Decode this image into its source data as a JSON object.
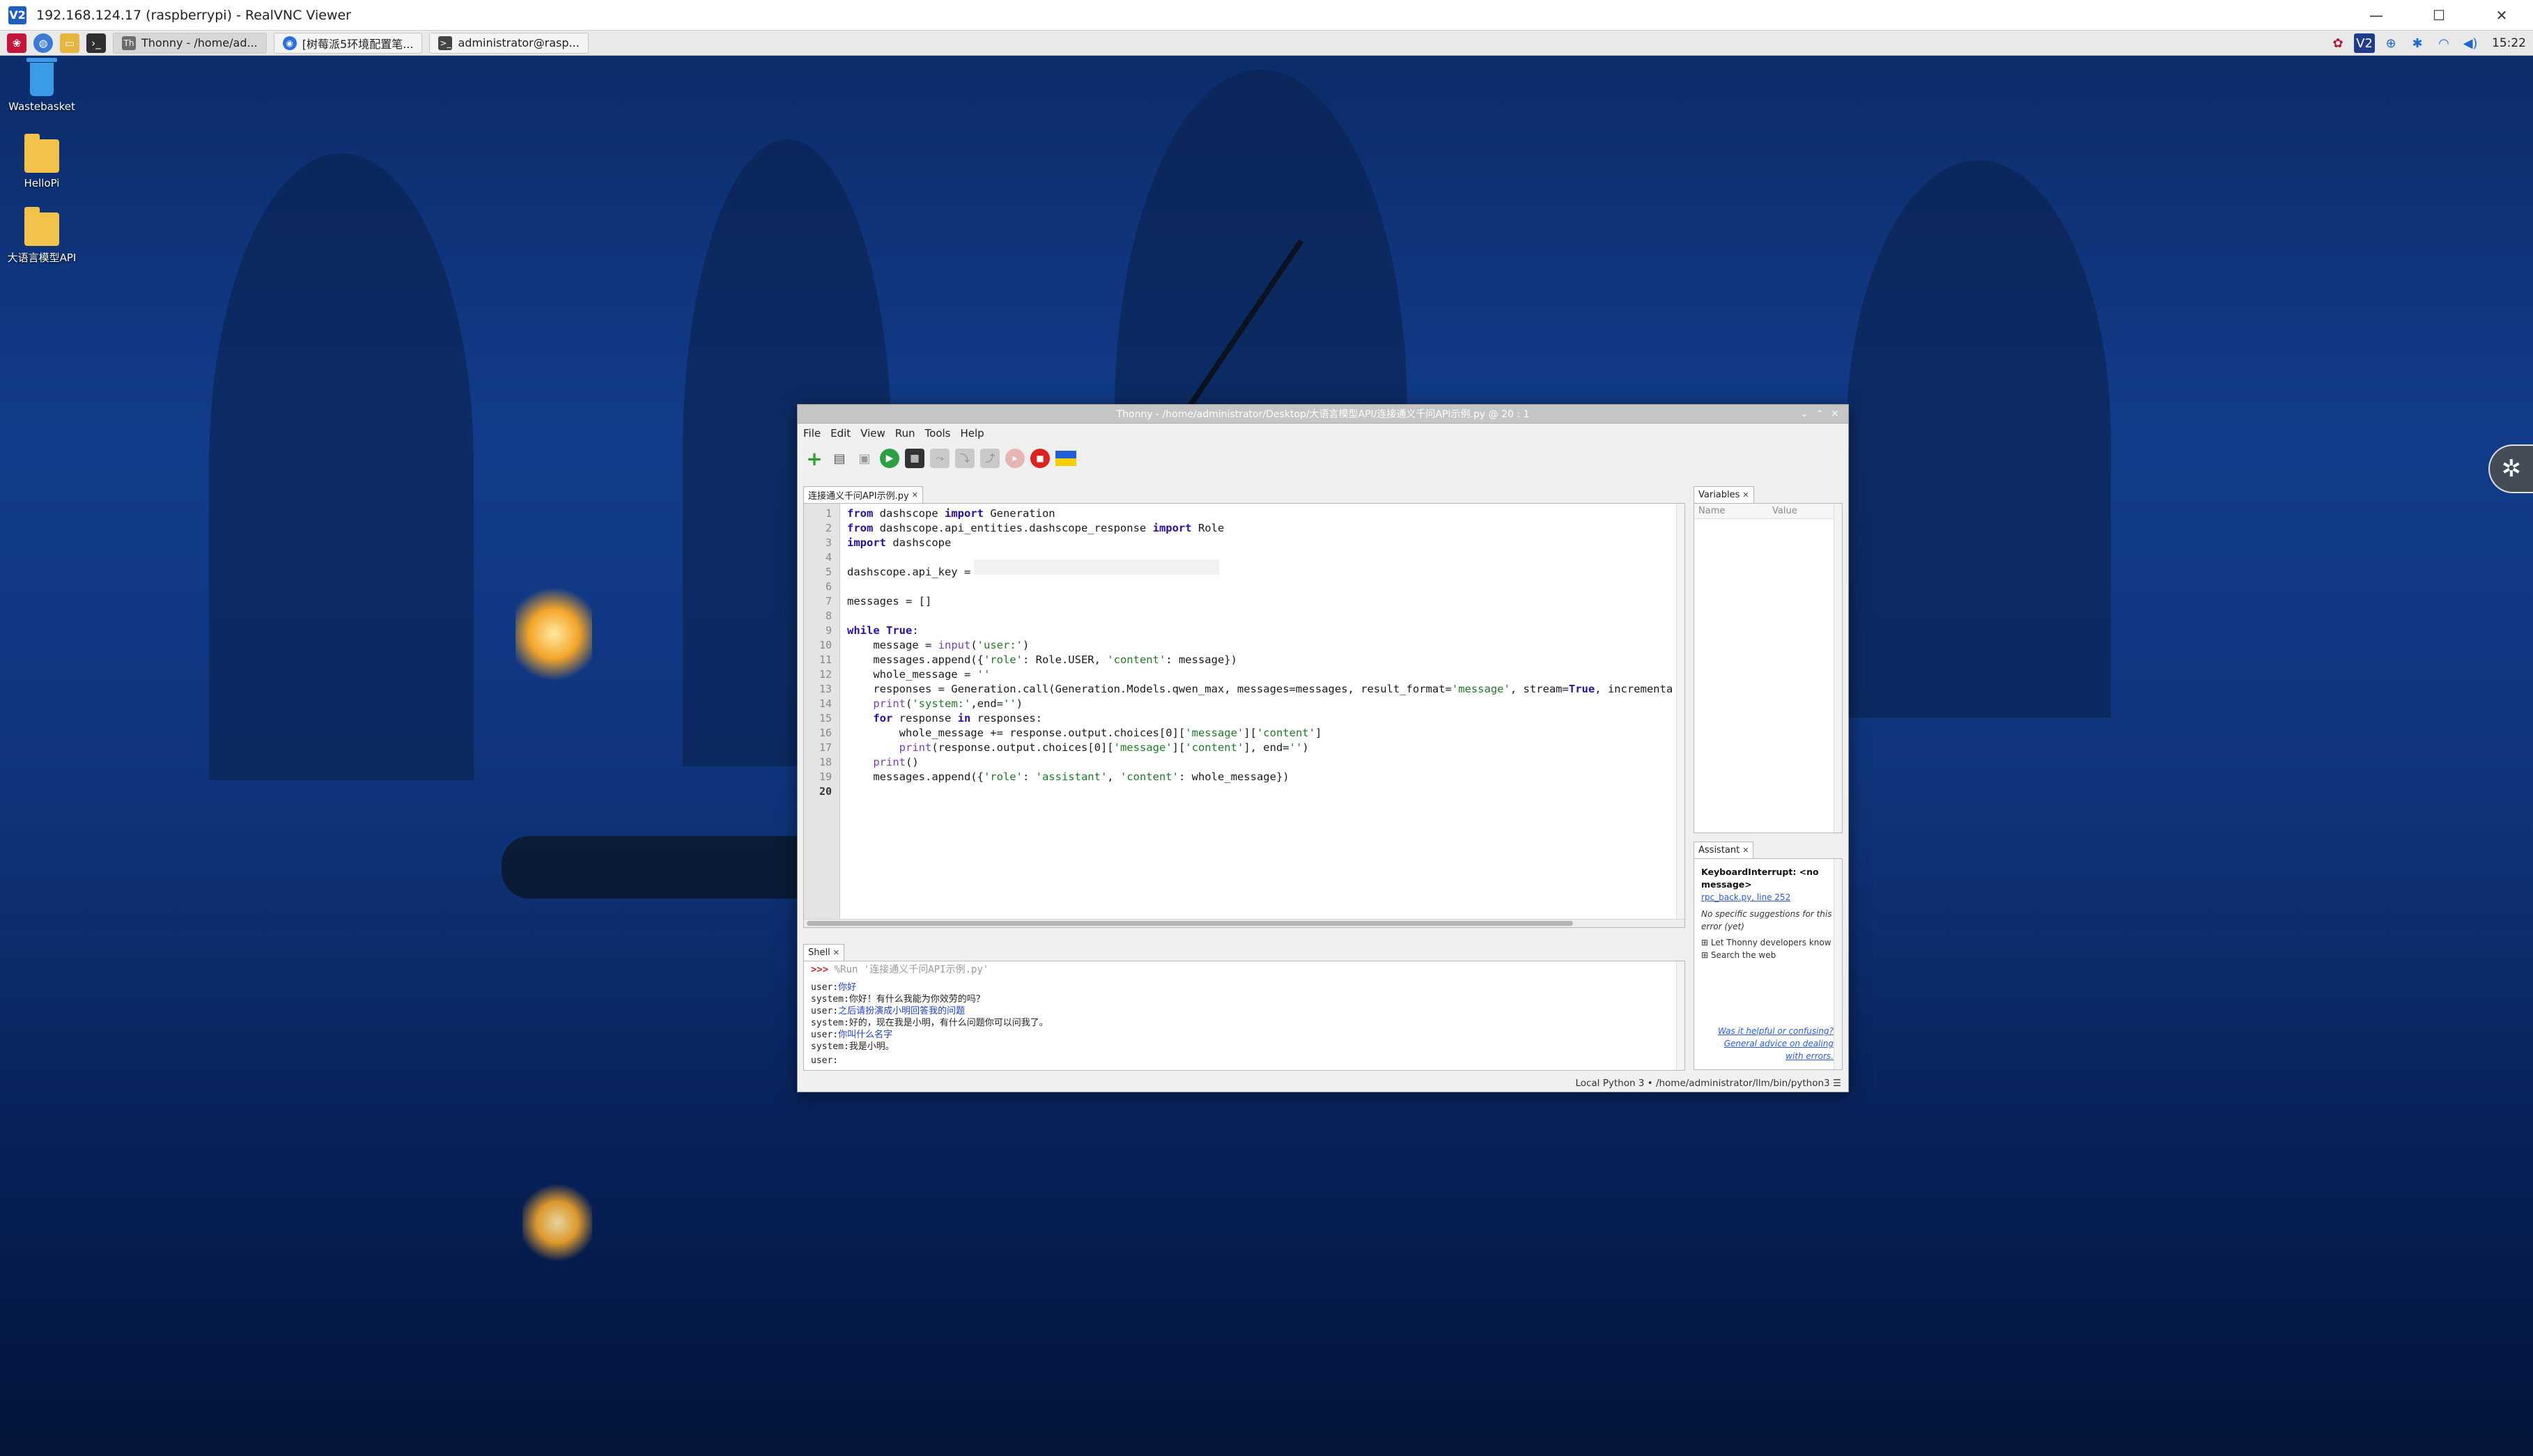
{
  "vnc": {
    "title": "192.168.124.17 (raspberrypi) - RealVNC Viewer",
    "icon": "V2",
    "controls": {
      "minimize": "—",
      "maximize": "☐",
      "close": "✕"
    }
  },
  "taskbar": {
    "tasks": [
      {
        "label": "Thonny - /home/ad...",
        "icon": "Th",
        "icon_color": "#6b6b6b"
      },
      {
        "label": "[树莓派5环境配置笔...",
        "icon": "◉",
        "icon_color": "#2a6fdb"
      },
      {
        "label": "administrator@rasp...",
        "icon": ">_",
        "icon_color": "#444444"
      }
    ],
    "clock": "15:22"
  },
  "desktop": {
    "icons": [
      {
        "label": "Wastebasket",
        "type": "trash"
      },
      {
        "label": "HelloPi",
        "type": "folder"
      },
      {
        "label": "大语言模型API",
        "type": "folder"
      }
    ]
  },
  "thonny": {
    "title": "Thonny  -  /home/administrator/Desktop/大语言模型API/连接通义千问API示例.py  @  20 : 1",
    "menu": [
      "File",
      "Edit",
      "View",
      "Run",
      "Tools",
      "Help"
    ],
    "editor_tab": "连接通义千问API示例.py",
    "code_lines": [
      "1",
      "2",
      "3",
      "4",
      "5",
      "6",
      "7",
      "8",
      "9",
      "10",
      "11",
      "12",
      "13",
      "14",
      "15",
      "16",
      "17",
      "18",
      "19",
      "20"
    ],
    "code": {
      "l1a": "from",
      "l1b": " dashscope ",
      "l1c": "import",
      "l1d": " Generation",
      "l2a": "from",
      "l2b": " dashscope.api_entities.dashscope_response ",
      "l2c": "import",
      "l2d": " Role",
      "l3a": "import",
      "l3b": " dashscope",
      "l5": "dashscope.api_key = ",
      "l7": "messages = []",
      "l9a": "while",
      "l9b": " ",
      "l9c": "True",
      "l9d": ":",
      "l10a": "    message = ",
      "l10b": "input",
      "l10c": "(",
      "l10d": "'user:'",
      "l10e": ")",
      "l11a": "    messages.append({",
      "l11b": "'role'",
      "l11c": ": Role.USER, ",
      "l11d": "'content'",
      "l11e": ": message})",
      "l12a": "    whole_message = ",
      "l12b": "''",
      "l13a": "    responses = Generation.call(Generation.Models.qwen_max, messages=messages, result_format=",
      "l13b": "'message'",
      "l13c": ", stream=",
      "l13d": "True",
      "l13e": ", incrementa",
      "l14a": "    ",
      "l14b": "print",
      "l14c": "(",
      "l14d": "'system:'",
      "l14e": ",end=",
      "l14f": "''",
      "l14g": ")",
      "l15a": "    ",
      "l15b": "for",
      "l15c": " response ",
      "l15d": "in",
      "l15e": " responses:",
      "l16a": "        whole_message += response.output.choices[",
      "l16b": "0",
      "l16c": "][",
      "l16d": "'message'",
      "l16e": "][",
      "l16f": "'content'",
      "l16g": "]",
      "l17a": "        ",
      "l17b": "print",
      "l17c": "(response.output.choices[",
      "l17d": "0",
      "l17e": "][",
      "l17f": "'message'",
      "l17g": "][",
      "l17h": "'content'",
      "l17i": "], end=",
      "l17j": "''",
      "l17k": ")",
      "l18a": "    ",
      "l18b": "print",
      "l18c": "()",
      "l19a": "    messages.append({",
      "l19b": "'role'",
      "l19c": ": ",
      "l19d": "'assistant'",
      "l19e": ", ",
      "l19f": "'content'",
      "l19g": ": whole_message})"
    },
    "shell_tab": "Shell",
    "shell": {
      "prompt": ">>>",
      "run_cmd": " %Run '连接通义千问API示例.py'",
      "lines": [
        {
          "pre": "user:",
          "in": "你好"
        },
        {
          "pre": "system:你好！有什么我能为你效劳的吗？",
          "in": ""
        },
        {
          "pre": "user:",
          "in": "之后请扮演成小明回答我的问题"
        },
        {
          "pre": "system:好的，现在我是小明，有什么问题你可以问我了。",
          "in": ""
        },
        {
          "pre": "user:",
          "in": "你叫什么名字"
        },
        {
          "pre": "system:我是小明。",
          "in": ""
        },
        {
          "pre": "user:",
          "in": ""
        }
      ]
    },
    "variables_tab": "Variables",
    "variables_headers": {
      "name": "Name",
      "value": "Value"
    },
    "assistant_tab": "Assistant",
    "assistant": {
      "error": "KeyboardInterrupt: <no message>",
      "link": "rpc_back.py, line 252",
      "no_suggestions": "No specific suggestions for this error (yet)",
      "opt1": "Let Thonny developers know",
      "opt2": "Search the web",
      "footer1": "Was it helpful or confusing?",
      "footer2": "General advice on dealing with errors."
    },
    "status": "Local Python 3  •  /home/administrator/llm/bin/python3  ☰"
  }
}
